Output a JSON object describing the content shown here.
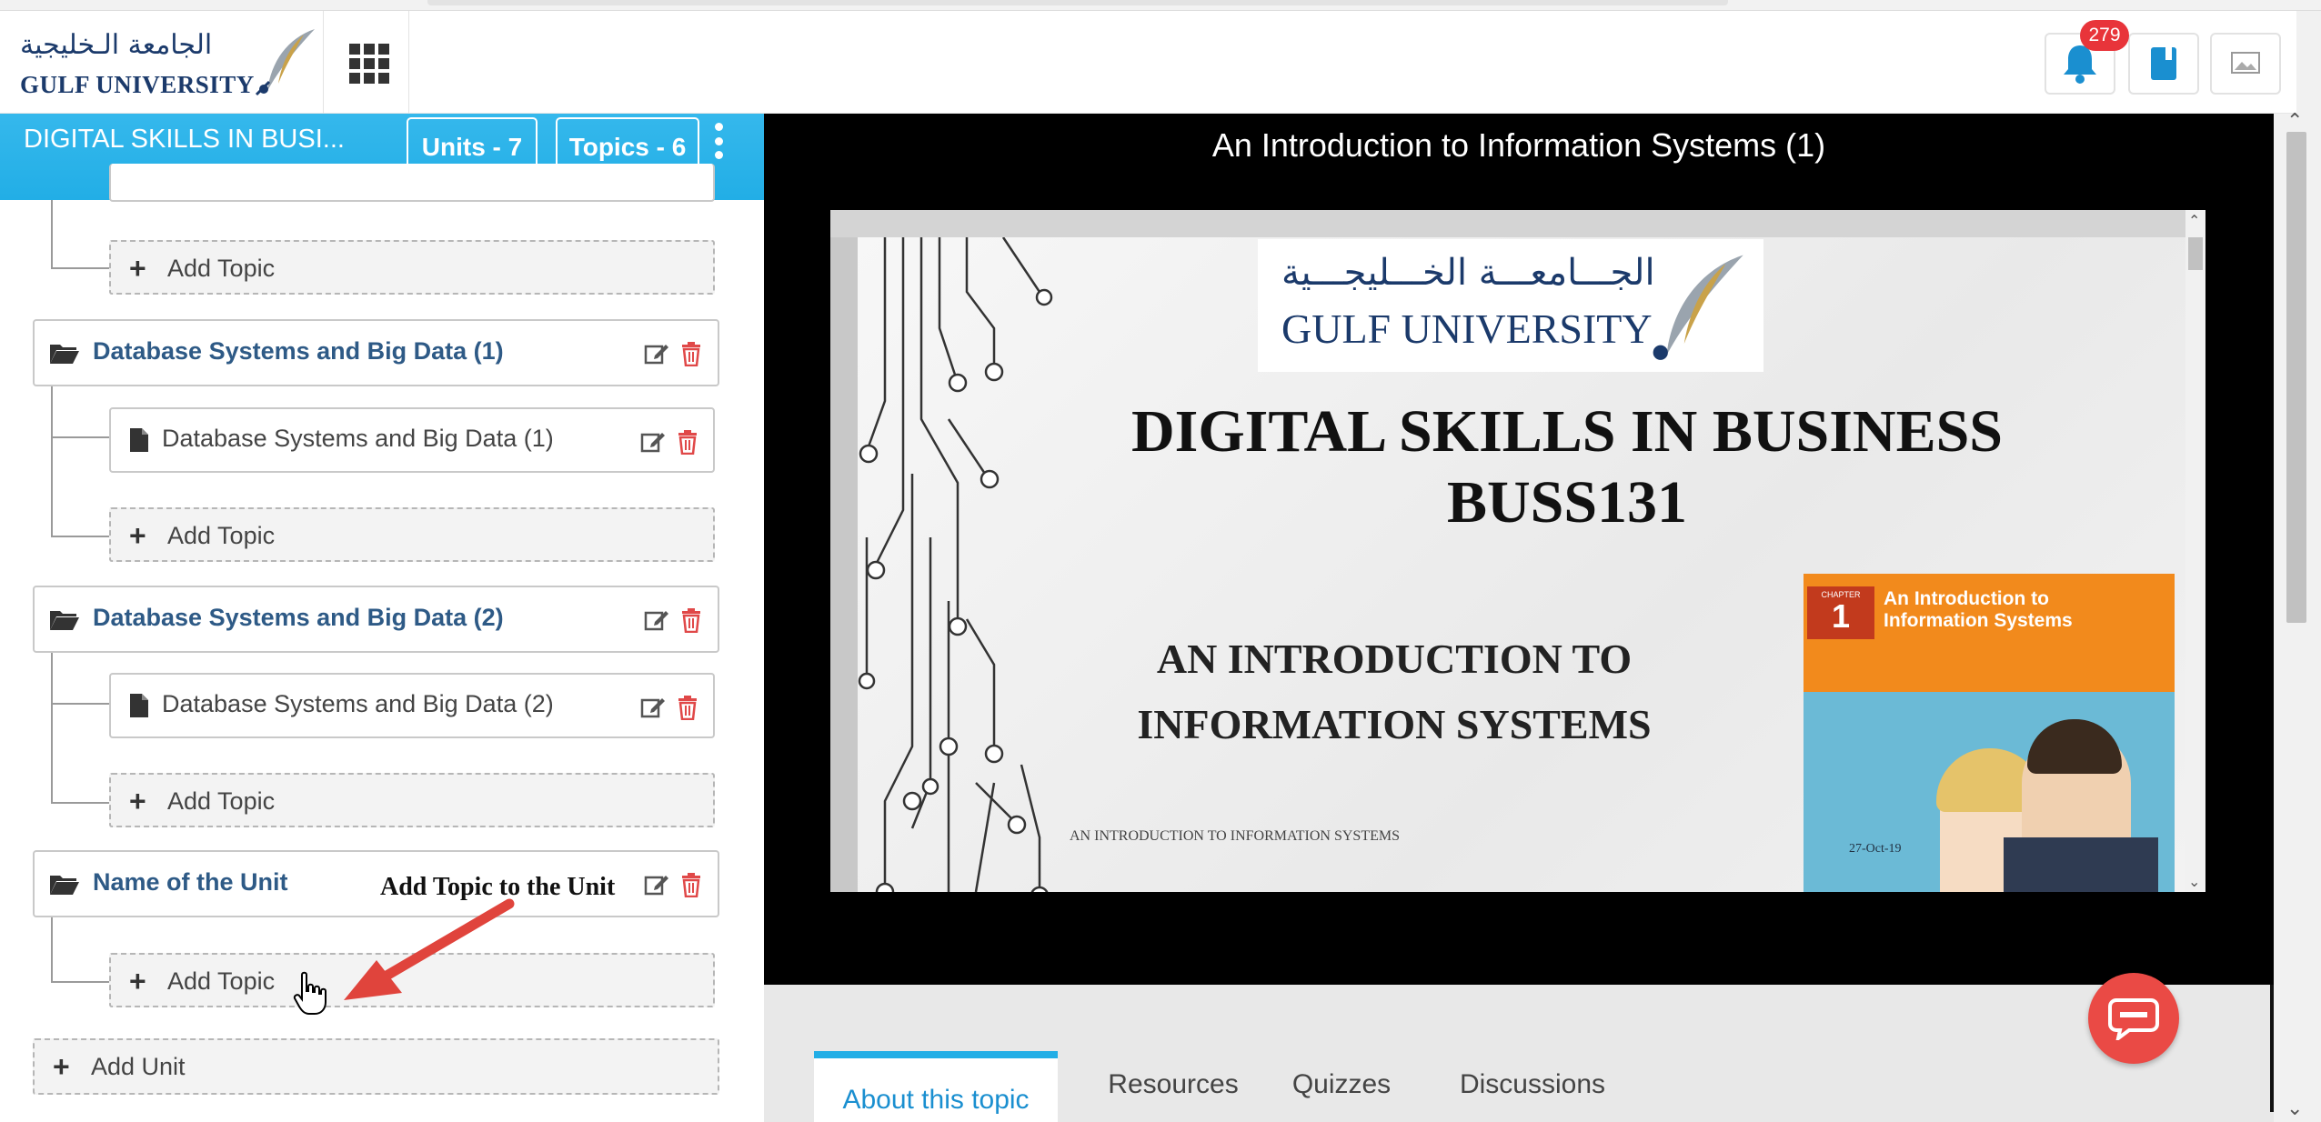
{
  "header": {
    "logo_arabic": "الجامعة الـخليجية",
    "logo_english": "GULF UNIVERSITY",
    "notifications_count": "279"
  },
  "sidebar": {
    "course_title": "DIGITAL SKILLS IN BUSI...",
    "units_label": "Units - 7",
    "topics_label": "Topics - 6",
    "add_topic_label": "Add Topic",
    "add_unit_label": "Add Unit",
    "units": [
      {
        "name": "Database Systems and Big Data (1)",
        "topics": [
          "Database Systems and Big Data (1)"
        ]
      },
      {
        "name": "Database Systems and Big Data (2)",
        "topics": [
          "Database Systems and Big Data (2)"
        ]
      },
      {
        "name": "Name of the Unit",
        "topics": []
      }
    ],
    "annotation": "Add Topic to the Unit"
  },
  "content": {
    "topic_title": "An Introduction to Information Systems (1)",
    "slide": {
      "logo_arabic": "الجـــامعـــة الخـــليجـــية",
      "logo_english": "GULF UNIVERSITY",
      "title_line1": "DIGITAL SKILLS IN BUSINESS",
      "title_line2": "BUSS131",
      "subtitle_line1": "AN INTRODUCTION TO",
      "subtitle_line2": "INFORMATION SYSTEMS",
      "footer_text": "AN INTRODUCTION TO INFORMATION SYSTEMS",
      "book_chapter_label": "CHAPTER",
      "book_chapter_number": "1",
      "book_title_line1": "An Introduction to",
      "book_title_line2": "Information Systems",
      "date": "27-Oct-19"
    },
    "tabs": [
      "About this topic",
      "Resources",
      "Quizzes",
      "Discussions"
    ]
  },
  "colors": {
    "accent": "#22aee6",
    "unit_text": "#2e5a86",
    "delete_red": "#e04848",
    "badge_red": "#e8343a",
    "fab_red": "#ea4a45",
    "annotation_arrow": "#e0443c"
  }
}
